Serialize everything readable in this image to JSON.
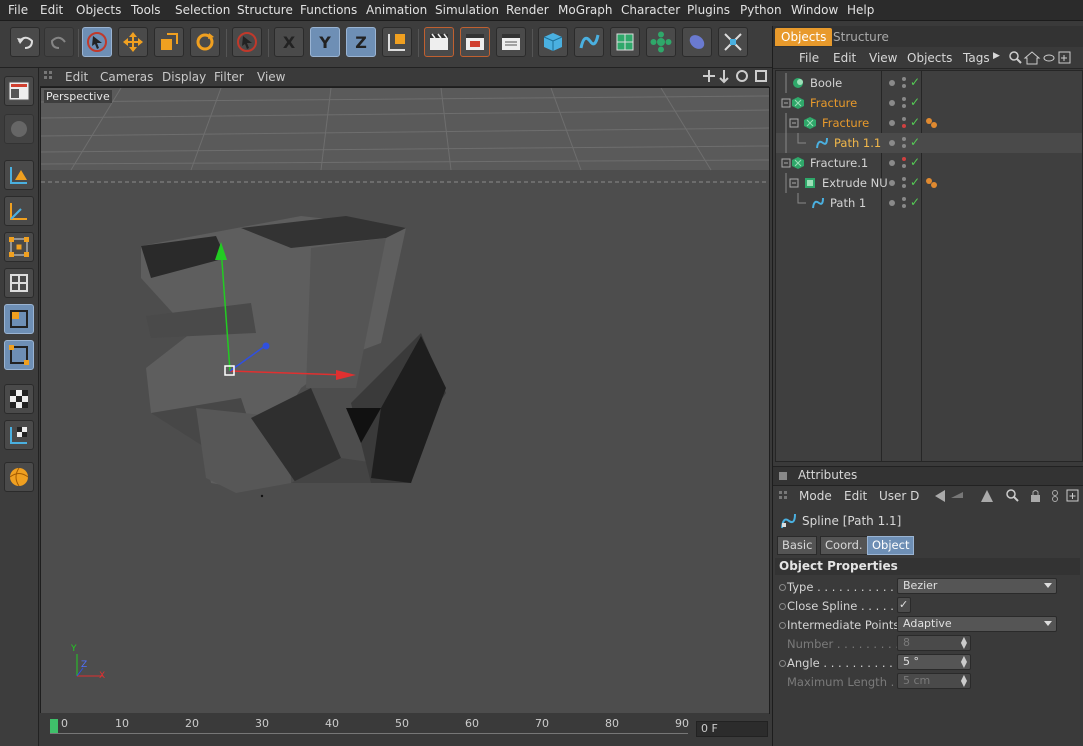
{
  "menu": [
    "File",
    "Edit",
    "Objects",
    "Tools",
    "Selection",
    "Structure",
    "Functions",
    "Animation",
    "Simulation",
    "Render",
    "MoGraph",
    "Character",
    "Plugins",
    "Python",
    "Window",
    "Help"
  ],
  "toolbar": {
    "axis_x": "X",
    "axis_y": "Y",
    "axis_z": "Z",
    "icons": [
      "undo-icon",
      "redo-icon",
      "live-selection-icon",
      "move-icon",
      "scale-icon",
      "rotate-icon",
      "recent-tools-icon",
      "x-axis-lock-icon",
      "y-axis-lock-icon",
      "z-axis-lock-icon",
      "coordinate-system-icon",
      "render-view-icon",
      "render-picture-viewer-icon",
      "render-settings-icon",
      "cube-icon",
      "spline-pen-icon",
      "subdivision-surface-icon",
      "array-icon",
      "deformer-icon",
      "camera-icon"
    ]
  },
  "viewport": {
    "menu": [
      "Edit",
      "Cameras",
      "Display",
      "Filter",
      "View"
    ],
    "label": "Perspective",
    "axis_labels": {
      "y": "Y",
      "z": "Z",
      "x": "X"
    }
  },
  "timeline": {
    "ticks": [
      "0",
      "10",
      "20",
      "30",
      "40",
      "50",
      "60",
      "70",
      "80",
      "90"
    ],
    "current_frame": "0 F"
  },
  "objects_panel": {
    "tabs": [
      "Objects",
      "Structure"
    ],
    "active_tab": "Objects",
    "menu": [
      "File",
      "Edit",
      "View",
      "Objects",
      "Tags"
    ],
    "items": [
      {
        "name": "Boole",
        "color": "normal",
        "indent": 0
      },
      {
        "name": "Fracture",
        "color": "orange",
        "indent": 0
      },
      {
        "name": "Fracture",
        "color": "orange",
        "indent": 1
      },
      {
        "name": "Path 1.1",
        "color": "highlight",
        "indent": 2
      },
      {
        "name": "Fracture.1",
        "color": "normal",
        "indent": 0
      },
      {
        "name": "Extrude NU",
        "color": "normal",
        "indent": 1
      },
      {
        "name": "Path 1",
        "color": "normal",
        "indent": 2
      }
    ]
  },
  "attributes": {
    "header": "Attributes",
    "menu": [
      "Mode",
      "Edit",
      "User D"
    ],
    "object_title": "Spline [Path 1.1]",
    "tabs": [
      "Basic",
      "Coord.",
      "Object"
    ],
    "active_tab": "Object",
    "section": "Object Properties",
    "props": [
      {
        "label": "Type . . . . . . . . . . . . . . .",
        "value": "Bezier",
        "kind": "dropdown",
        "enabled": true
      },
      {
        "label": "Close Spline . . . . . . .",
        "value": "✓",
        "kind": "checkbox",
        "enabled": true
      },
      {
        "label": "Intermediate Points",
        "value": "Adaptive",
        "kind": "dropdown",
        "enabled": true
      },
      {
        "label": "Number . . . . . . . . . . .",
        "value": "8",
        "kind": "number",
        "enabled": false
      },
      {
        "label": "Angle . . . . . . . . . . . . . .",
        "value": "5 °",
        "kind": "number",
        "enabled": true
      },
      {
        "label": "Maximum Length . .",
        "value": "5 cm",
        "kind": "number",
        "enabled": false
      }
    ]
  }
}
